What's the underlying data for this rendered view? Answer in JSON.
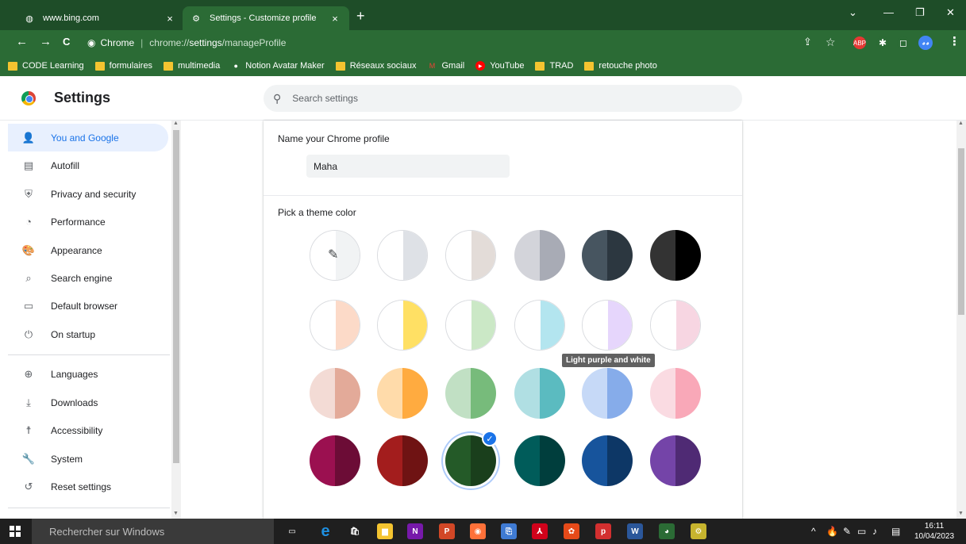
{
  "tabs": [
    {
      "title": "www.bing.com",
      "icon": "globe-icon",
      "close": "×"
    },
    {
      "title": "Settings - Customize profile",
      "icon": "gear-icon",
      "close": "×"
    }
  ],
  "new_tab": "+",
  "window_controls": {
    "tabs_menu": "⌄",
    "minimize": "—",
    "restore": "❐",
    "close": "✕"
  },
  "toolbar": {
    "back": "←",
    "forward": "→",
    "reload": "C",
    "site_label": "Chrome",
    "url_prefix": "chrome://",
    "url_host": "settings",
    "url_path": "/manageProfile",
    "share": "⇪",
    "star": "☆",
    "menu": "⋮",
    "extensions": [
      {
        "name": "adblock-icon",
        "text": "ABP",
        "color": "#e53935"
      },
      {
        "name": "puzzle-icon",
        "text": "✱",
        "color": "#2b6b35"
      },
      {
        "name": "sidepanel-icon",
        "text": "◻",
        "color": "#2b6b35"
      },
      {
        "name": "profile-avatar-icon",
        "text": "◕◕",
        "color": "#4285f4"
      }
    ]
  },
  "bookmarks": [
    {
      "label": "CODE Learning",
      "type": "folder"
    },
    {
      "label": "formulaires",
      "type": "folder"
    },
    {
      "label": "multimedia",
      "type": "folder"
    },
    {
      "label": "Notion Avatar Maker",
      "type": "site",
      "icon": "notion-avatar-icon",
      "glyph": "●"
    },
    {
      "label": "Réseaux sociaux",
      "type": "folder"
    },
    {
      "label": "Gmail",
      "type": "site",
      "icon": "gmail-icon",
      "glyph": "M"
    },
    {
      "label": "YouTube",
      "type": "site",
      "icon": "youtube-icon",
      "glyph": "▶"
    },
    {
      "label": "TRAD",
      "type": "folder"
    },
    {
      "label": "retouche photo",
      "type": "folder"
    }
  ],
  "header": {
    "title": "Settings",
    "search_placeholder": "Search settings"
  },
  "sidebar": {
    "items": [
      {
        "label": "You and Google",
        "icon": "person-icon",
        "glyph": "👤",
        "active": true
      },
      {
        "label": "Autofill",
        "icon": "clipboard-icon",
        "glyph": "▤"
      },
      {
        "label": "Privacy and security",
        "icon": "shield-icon",
        "glyph": "⛨"
      },
      {
        "label": "Performance",
        "icon": "speedometer-icon",
        "glyph": "◔"
      },
      {
        "label": "Appearance",
        "icon": "palette-icon",
        "glyph": "🎨"
      },
      {
        "label": "Search engine",
        "icon": "search-icon",
        "glyph": "⌕"
      },
      {
        "label": "Default browser",
        "icon": "browser-window-icon",
        "glyph": "▭"
      },
      {
        "label": "On startup",
        "icon": "power-icon",
        "glyph": "⏻"
      },
      {
        "label": "Languages",
        "icon": "globe-icon",
        "glyph": "⊕"
      },
      {
        "label": "Downloads",
        "icon": "download-icon",
        "glyph": "⤓"
      },
      {
        "label": "Accessibility",
        "icon": "accessibility-icon",
        "glyph": "☨"
      },
      {
        "label": "System",
        "icon": "wrench-icon",
        "glyph": "🔧"
      },
      {
        "label": "Reset settings",
        "icon": "reset-history-icon",
        "glyph": "↺"
      }
    ]
  },
  "profile": {
    "name_label": "Name your Chrome profile",
    "name_value": "Maha",
    "theme_label": "Pick a theme color",
    "tooltip": "Light purple and white",
    "swatches": [
      [
        {
          "kind": "custom",
          "left": "#ffffff",
          "right": "#f1f3f4",
          "icon": "eyedropper-icon"
        },
        {
          "left": "#ffffff",
          "right": "#dee1e6"
        },
        {
          "left": "#ffffff",
          "right": "#e3dcd8"
        },
        {
          "left": "#d3d4da",
          "right": "#a8abb5"
        },
        {
          "left": "#475560",
          "right": "#2c3740"
        },
        {
          "left": "#333333",
          "right": "#000000"
        }
      ],
      [
        {
          "left": "#ffffff",
          "right": "#fcdac8"
        },
        {
          "left": "#ffffff",
          "right": "#ffe064"
        },
        {
          "left": "#ffffff",
          "right": "#cbe8c6"
        },
        {
          "left": "#ffffff",
          "right": "#b3e5ef"
        },
        {
          "left": "#ffffff",
          "right": "#e6d6fc"
        },
        {
          "left": "#ffffff",
          "right": "#f7d6e2"
        }
      ],
      [
        {
          "left": "#f3dbd5",
          "right": "#e3aa99"
        },
        {
          "left": "#ffdbaa",
          "right": "#ffab40"
        },
        {
          "left": "#c1e0c4",
          "right": "#77bb7b"
        },
        {
          "left": "#b0dfe3",
          "right": "#5bbbc0"
        },
        {
          "left": "#c6d9f7",
          "right": "#86acea"
        },
        {
          "left": "#fadbe2",
          "right": "#f9a8b8"
        }
      ],
      [
        {
          "left": "#9b1050",
          "right": "#6c0c36"
        },
        {
          "left": "#a31d1d",
          "right": "#6f1313"
        },
        {
          "left": "#245a28",
          "right": "#1a3f1c",
          "selected": true
        },
        {
          "left": "#005c5a",
          "right": "#003e3d"
        },
        {
          "left": "#17549c",
          "right": "#0d3766"
        },
        {
          "left": "#7444a8",
          "right": "#4f2a74"
        }
      ]
    ]
  },
  "taskbar": {
    "search_placeholder": "Rechercher sur Windows",
    "apps": [
      {
        "name": "task-view-icon",
        "text": "▭",
        "color": "transparent"
      },
      {
        "name": "edge-icon",
        "text": "e",
        "color": "#1a78c2"
      },
      {
        "name": "store-icon",
        "text": "🛍",
        "color": "transparent"
      },
      {
        "name": "file-explorer-icon",
        "text": "▆",
        "color": "#f4c430"
      },
      {
        "name": "onenote-icon",
        "text": "N",
        "color": "#7719aa"
      },
      {
        "name": "powerpoint-icon",
        "text": "P",
        "color": "#d24726"
      },
      {
        "name": "firefox-icon",
        "text": "◉",
        "color": "#ff7139"
      },
      {
        "name": "network-app-icon",
        "text": "⎘",
        "color": "#3f7bd3"
      },
      {
        "name": "acrobat-icon",
        "text": "⅄",
        "color": "#d0021b"
      },
      {
        "name": "photo-app-icon",
        "text": "✿",
        "color": "#e64a19"
      },
      {
        "name": "p-app-icon",
        "text": "p",
        "color": "#d32f2f"
      },
      {
        "name": "word-icon",
        "text": "W",
        "color": "#2b579a"
      },
      {
        "name": "chrome-taskbar-icon",
        "text": "◕",
        "color": "#2b6b35"
      },
      {
        "name": "settings-app-icon",
        "text": "⚙",
        "color": "#c7b42e"
      }
    ],
    "tray": {
      "chevron": "^",
      "time": "16:11",
      "date": "10/04/2023"
    }
  }
}
